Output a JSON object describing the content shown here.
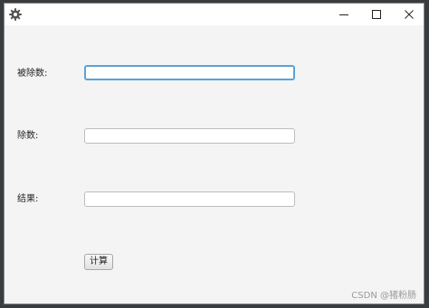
{
  "window": {
    "icon": "gear-icon",
    "controls": [
      "minimize-icon",
      "maximize-icon",
      "close-icon"
    ]
  },
  "form": {
    "dividend_label": "被除数:",
    "dividend_value": "",
    "divisor_label": "除数:",
    "divisor_value": "",
    "result_label": "结果:",
    "result_value": "",
    "calculate_label": "计算"
  },
  "watermark": "CSDN @猪粉肠",
  "colors": {
    "focus_border": "#5ba2d8",
    "window_bg": "#f4f4f4",
    "titlebar_bg": "#ffffff"
  }
}
